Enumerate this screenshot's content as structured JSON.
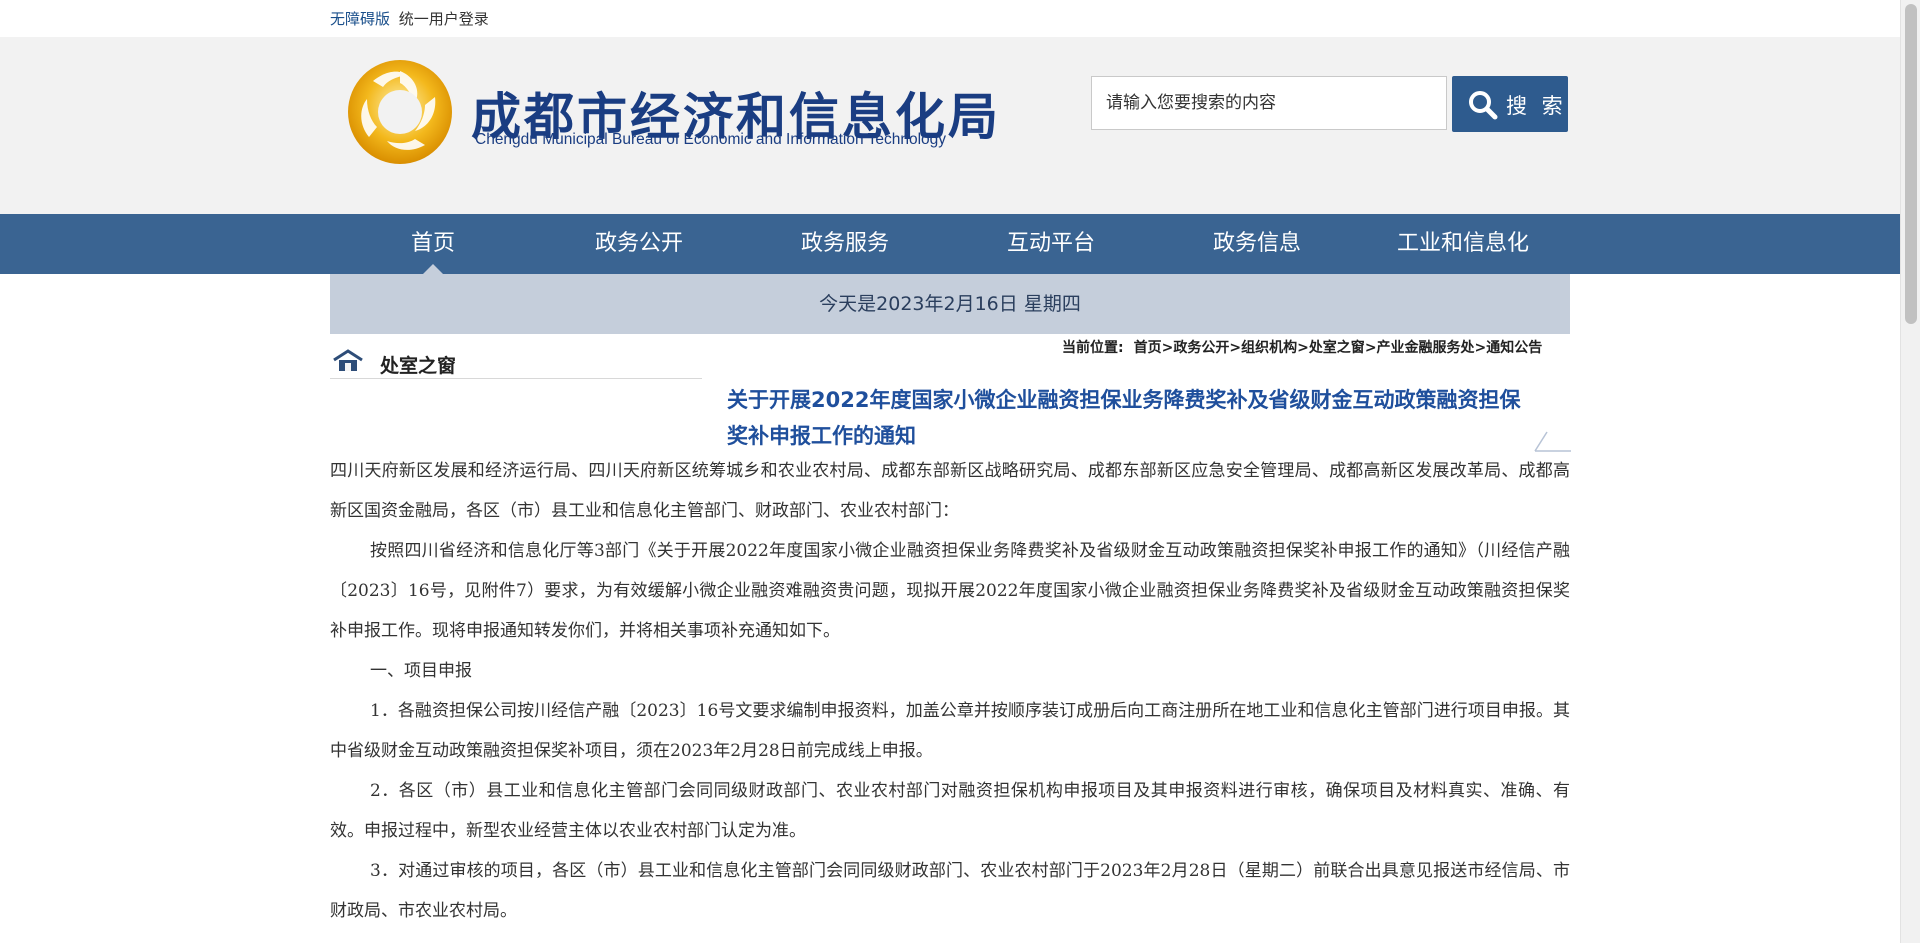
{
  "topbar": {
    "accessibility": "无障碍版",
    "login": "统一用户登录"
  },
  "header": {
    "title": "成都市经济和信息化局",
    "subtitle": "Chengdu Municipal Bureau of Economic and Information Technology",
    "search_placeholder": "请输入您要搜索的内容",
    "search_button": "搜 索"
  },
  "nav": [
    "首页",
    "政务公开",
    "政务服务",
    "互动平台",
    "政务信息",
    "工业和信息化"
  ],
  "datebar": "今天是2023年2月16日 星期四",
  "sidebar": {
    "title": "处室之窗"
  },
  "breadcrumb": {
    "label": "当前位置:",
    "items": [
      "首页",
      "政务公开",
      "组织机构",
      "处室之窗",
      "产业金融服务处",
      "通知公告"
    ]
  },
  "article": {
    "title": "关于开展2022年度国家小微企业融资担保业务降费奖补及省级财金互动政策融资担保奖补申报工作的通知",
    "paragraphs": [
      "四川天府新区发展和经济运行局、四川天府新区统筹城乡和农业农村局、成都东部新区战略研究局、成都东部新区应急安全管理局、成都高新区发展改革局、成都高新区国资金融局，各区（市）县工业和信息化主管部门、财政部门、农业农村部门：",
      "按照四川省经济和信息化厅等3部门《关于开展2022年度国家小微企业融资担保业务降费奖补及省级财金互动政策融资担保奖补申报工作的通知》（川经信产融〔2023〕16号，见附件7）要求，为有效缓解小微企业融资难融资贵问题，现拟开展2022年度国家小微企业融资担保业务降费奖补及省级财金互动政策融资担保奖补申报工作。现将申报通知转发你们，并将相关事项补充通知如下。",
      "一、项目申报",
      "1．各融资担保公司按川经信产融〔2023〕16号文要求编制申报资料，加盖公章并按顺序装订成册后向工商注册所在地工业和信息化主管部门进行项目申报。其中省级财金互动政策融资担保奖补项目，须在2023年2月28日前完成线上申报。",
      "2．各区（市）县工业和信息化主管部门会同同级财政部门、农业农村部门对融资担保机构申报项目及其申报资料进行审核，确保项目及材料真实、准确、有效。申报过程中，新型农业经营主体以农业农村部门认定为准。",
      "3．对通过审核的项目，各区（市）县工业和信息化主管部门会同同级财政部门、农业农村部门于2023年2月28日（星期二）前联合出具意见报送市经信局、市财政局、市农业农村局。"
    ]
  },
  "colors": {
    "nav_bg": "#3a6492",
    "title_blue": "#1f4f9c",
    "date_bar": "#c5cedb"
  },
  "icons": [
    "sun-logo-icon",
    "search-icon",
    "home-icon"
  ]
}
